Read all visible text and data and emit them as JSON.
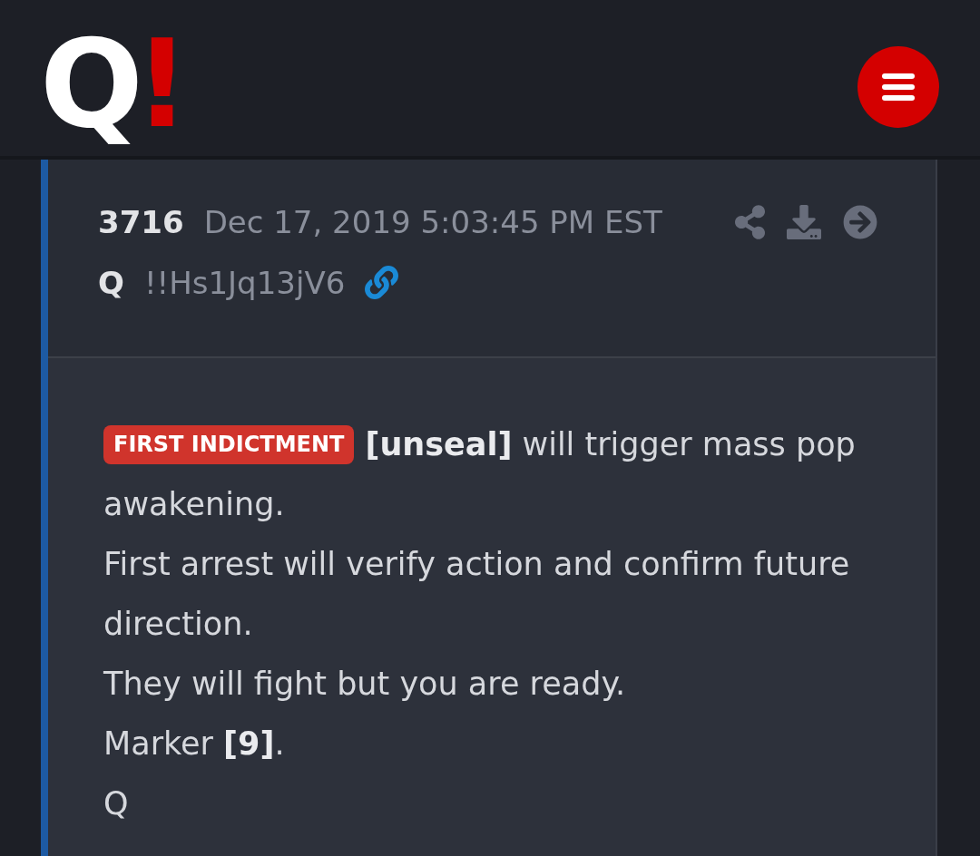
{
  "header": {
    "logo": {
      "letter": "Q",
      "mark": "!"
    }
  },
  "post": {
    "number": "3716",
    "timestamp": "Dec 17, 2019 5:03:45 PM EST",
    "author": "Q",
    "tripcode": "!!Hs1Jq13jV6"
  },
  "body": {
    "paragraphs": [
      {
        "tag": "FIRST INDICTMENT",
        "text": "**[unseal]** will trigger mass pop"
      },
      {
        "text": "awakening."
      },
      {
        "text": "First arrest will verify action and confirm future direction."
      },
      {
        "text": "They will fight but you are ready."
      },
      {
        "text": "Marker **[9]**."
      },
      {
        "text": "Q"
      }
    ]
  }
}
